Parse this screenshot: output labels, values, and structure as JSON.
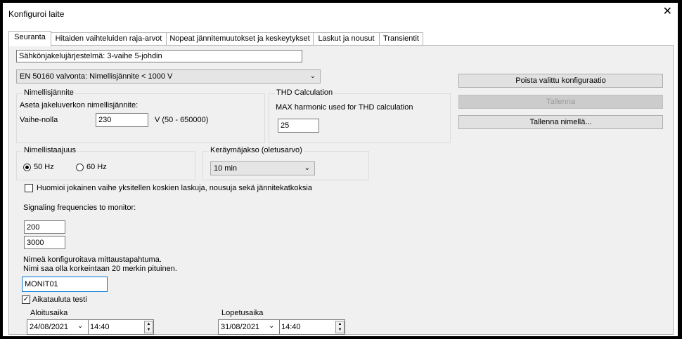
{
  "window": {
    "title": "Konfiguroi laite",
    "close": "✕"
  },
  "tabs": [
    "Seuranta",
    "Hitaiden vaihteluiden raja-arvot",
    "Nopeat jännitemuutokset ja keskeytykset",
    "Laskut ja nousut",
    "Transientit"
  ],
  "system_field": {
    "value": "Sähkönjakelujärjestelmä: 3-vaihe 5-johdin"
  },
  "monitoring_select": {
    "value": "EN 50160 valvonta: Nimellisjännite < 1000 V"
  },
  "buttons": {
    "delete": "Poista valittu konfiguraatio",
    "save": "Tallenna",
    "save_as": "Tallenna nimellä..."
  },
  "nominal_voltage": {
    "group_label": "Nimellisjännite",
    "description": "Aseta jakeluverkon nimellisjännite:",
    "field_label": "Vaihe-nolla",
    "value": "230",
    "unit_range": "V (50 - 650000)"
  },
  "thd": {
    "group_label": "THD Calculation",
    "description": "MAX harmonic used for THD calculation",
    "value": "25"
  },
  "frequency": {
    "group_label": "Nimellistaajuus",
    "option_50": "50 Hz",
    "option_60": "60 Hz",
    "selected": "50 Hz"
  },
  "interval": {
    "group_label": "Keräymäjakso (oletusarvo)",
    "value": "10 min"
  },
  "each_phase_checkbox": {
    "label": "Huomioi jokainen vaihe yksitellen koskien laskuja, nousuja sekä jännitekatkoksia",
    "checked": false
  },
  "signaling": {
    "label": "Signaling frequencies to monitor:",
    "values": [
      "200",
      "3000"
    ]
  },
  "event_name": {
    "line1": "Nimeä konfiguroitava mittaustapahtuma.",
    "line2": "Nimi saa olla korkeintaan 20 merkin pituinen.",
    "value": "MONIT01"
  },
  "schedule": {
    "checkbox_label": "Aikatauluta testi",
    "checked": true,
    "start_label": "Aloitusaika",
    "start_date": "24/08/2021",
    "start_time": "14:40",
    "end_label": "Lopetusaika",
    "end_date": "31/08/2021",
    "end_time": "14:40"
  }
}
